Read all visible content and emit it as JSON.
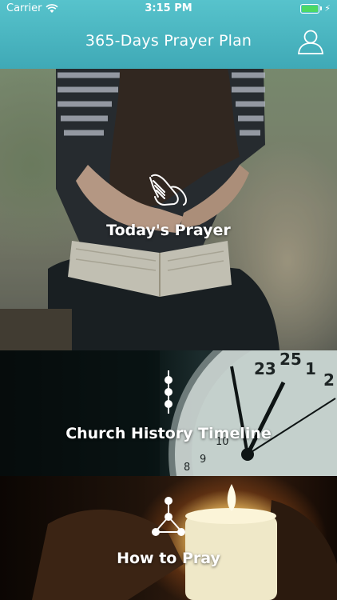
{
  "status_bar": {
    "carrier": "Carrier",
    "time": "3:15 PM"
  },
  "nav": {
    "title": "365-Days Prayer Plan",
    "profile_icon": "user-icon"
  },
  "panels": [
    {
      "label": "Today's Prayer",
      "icon": "praying-hands-icon"
    },
    {
      "label": "Church History Timeline",
      "icon": "timeline-icon"
    },
    {
      "label": "How to Pray",
      "icon": "branch-network-icon"
    }
  ],
  "colors": {
    "header": "#4bb8c2",
    "battery": "#4cd964",
    "text": "#ffffff"
  }
}
